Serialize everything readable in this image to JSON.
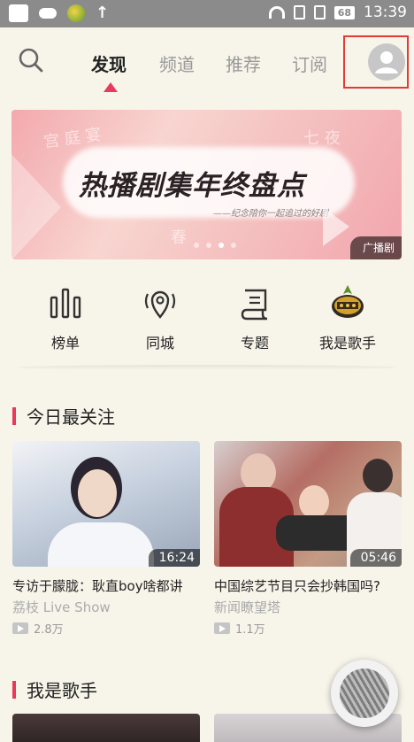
{
  "status_bar": {
    "battery": "68",
    "time": "13:39"
  },
  "top_nav": {
    "tabs": [
      {
        "label": "发现",
        "active": true
      },
      {
        "label": "频道",
        "active": false
      },
      {
        "label": "推荐",
        "active": false
      },
      {
        "label": "订阅",
        "active": false
      }
    ],
    "accent_color": "#e83a5e"
  },
  "banner": {
    "title": "热播剧集年终盘点",
    "subtitle": "——纪念陪你一起追过的好剧",
    "tag": "广播剧",
    "slide_count": 4,
    "active_slide": 3
  },
  "quick_menu": [
    {
      "label": "榜单",
      "icon": "bar-chart-icon"
    },
    {
      "label": "同城",
      "icon": "location-pin-icon"
    },
    {
      "label": "专题",
      "icon": "scroll-icon"
    },
    {
      "label": "我是歌手",
      "icon": "singer-logo-icon"
    }
  ],
  "sections": [
    {
      "title": "今日最关注",
      "videos": [
        {
          "title": "专访于朦胧：耿直boy啥都讲",
          "source": "荔枝 Live Show",
          "views": "2.8万",
          "duration": "16:24"
        },
        {
          "title": "中国综艺节目只会抄韩国吗?",
          "source": "新闻瞭望塔",
          "views": "1.1万",
          "duration": "05:46"
        }
      ]
    },
    {
      "title": "我是歌手"
    }
  ]
}
